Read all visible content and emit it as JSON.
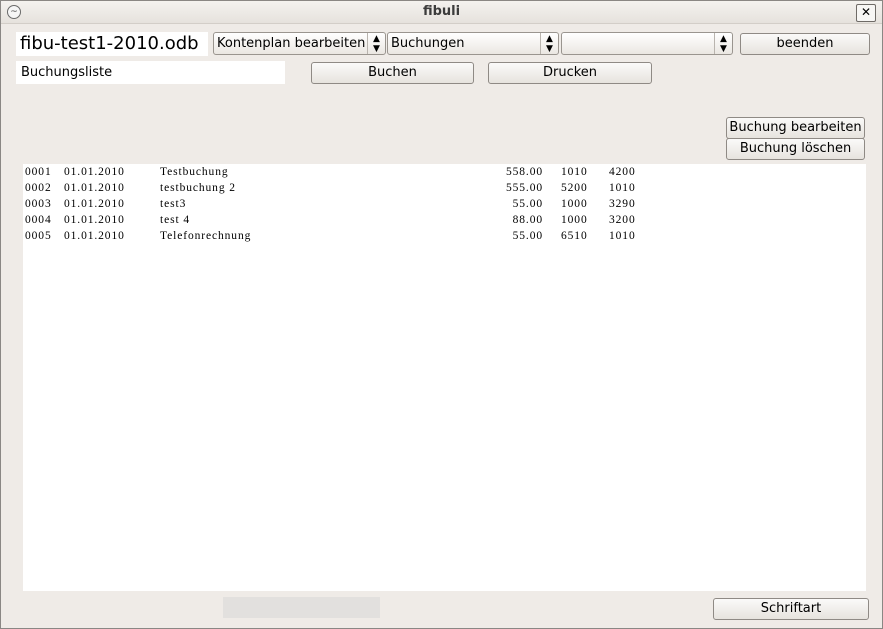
{
  "window": {
    "title": "fibuli",
    "close_label": "✕",
    "icon_glyph": "~"
  },
  "header": {
    "filename": "fibu-test1-2010.odb",
    "combo_kontenplan": "Kontenplan bearbeiten",
    "combo_buchungen": "Buchungen",
    "combo_third": "",
    "beenden_label": "beenden",
    "list_label": "Buchungsliste",
    "buchen_label": "Buchen",
    "drucken_label": "Drucken"
  },
  "actions": {
    "bearbeiten_label": "Buchung bearbeiten",
    "loeschen_label": "Buchung löschen",
    "schriftart_label": "Schriftart"
  },
  "bookings": [
    {
      "nr": "0001",
      "date": "01.01.2010",
      "text": "Testbuchung",
      "amount": "558.00",
      "soll": "1010",
      "haben": "4200"
    },
    {
      "nr": "0002",
      "date": "01.01.2010",
      "text": "testbuchung 2",
      "amount": "555.00",
      "soll": "5200",
      "haben": "1010"
    },
    {
      "nr": "0003",
      "date": "01.01.2010",
      "text": "test3",
      "amount": "55.00",
      "soll": "1000",
      "haben": "3290"
    },
    {
      "nr": "0004",
      "date": "01.01.2010",
      "text": "test 4",
      "amount": "88.00",
      "soll": "1000",
      "haben": "3200"
    },
    {
      "nr": "0005",
      "date": "01.01.2010",
      "text": "Telefonrechnung",
      "amount": "55.00",
      "soll": "6510",
      "haben": "1010"
    }
  ],
  "icons": {
    "app": "fibuli-app-icon",
    "close": "close-icon",
    "combo_arrow": "updown-arrow-icon"
  }
}
